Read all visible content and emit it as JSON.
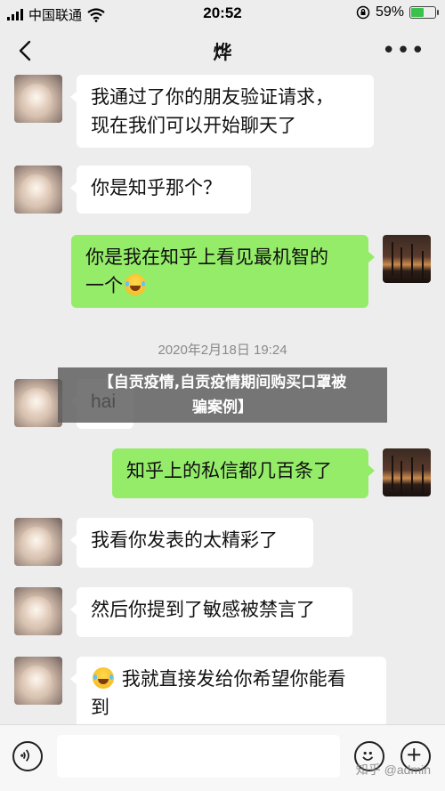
{
  "status_bar": {
    "carrier": "中国联通",
    "time": "20:52",
    "battery": "59%",
    "battery_level": 0.59
  },
  "header": {
    "title": "烨",
    "back_icon": "chevron-left-icon",
    "more_label": "•••"
  },
  "messages": [
    {
      "side": "left",
      "text_lines": [
        "我通过了你的朋友验证请求，",
        "现在我们可以开始聊天了"
      ]
    },
    {
      "side": "left",
      "text": "你是知乎那个？"
    },
    {
      "side": "right",
      "text_lines": [
        "你是我在知乎上看见最机智的",
        "一个"
      ],
      "emoji": "laughing-crying-emoji"
    },
    {
      "timestamp": "2020年2月18日 19:24"
    },
    {
      "side": "left",
      "text": "hai"
    },
    {
      "side": "right",
      "text": "知乎上的私信都几百条了"
    },
    {
      "side": "left",
      "text": "我看你发表的太精彩了"
    },
    {
      "side": "left",
      "text": "然后你提到了敏感被禁言了"
    },
    {
      "side": "left",
      "emoji": "laughing-crying-emoji",
      "text_lines": [
        "我就直接发给你希望你能看",
        "到"
      ]
    }
  ],
  "overlay": {
    "line1": "【自贡疫情,自贡疫情期间购买口罩被",
    "line2": "骗案例】"
  },
  "input_bar": {
    "voice_icon": "voice-icon",
    "emoji_icon": "smiley-icon",
    "plus_icon": "plus-icon",
    "watermark": "知乎 @admin"
  },
  "colors": {
    "background": "#ededed",
    "bubble_self": "#95ec69",
    "bubble_other": "#ffffff"
  }
}
